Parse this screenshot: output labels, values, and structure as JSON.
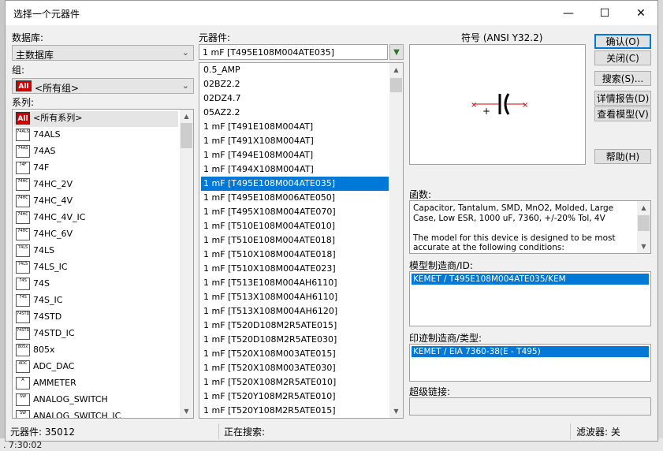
{
  "window": {
    "title": "选择一个元器件",
    "minimize": "—",
    "maximize": "☐",
    "close": "✕"
  },
  "left": {
    "db_label": "数据库:",
    "db_value": "主数据库",
    "group_label": "组:",
    "group_value": "<所有组>",
    "series_label": "系列:",
    "series": [
      {
        "icon": "All",
        "label": "<所有系列>"
      },
      {
        "icon": "74ALS",
        "label": "74ALS"
      },
      {
        "icon": "74AS",
        "label": "74AS"
      },
      {
        "icon": "74F",
        "label": "74F"
      },
      {
        "icon": "74HC",
        "label": "74HC_2V"
      },
      {
        "icon": "74HC",
        "label": "74HC_4V"
      },
      {
        "icon": "74HC",
        "label": "74HC_4V_IC"
      },
      {
        "icon": "74HC",
        "label": "74HC_6V"
      },
      {
        "icon": "74LS",
        "label": "74LS"
      },
      {
        "icon": "74LS",
        "label": "74LS_IC"
      },
      {
        "icon": "74S",
        "label": "74S"
      },
      {
        "icon": "74S",
        "label": "74S_IC"
      },
      {
        "icon": "74STD",
        "label": "74STD"
      },
      {
        "icon": "74STD",
        "label": "74STD_IC"
      },
      {
        "icon": "805x",
        "label": "805x"
      },
      {
        "icon": "ADC",
        "label": "ADC_DAC"
      },
      {
        "icon": "A",
        "label": "AMMETER"
      },
      {
        "icon": "SW",
        "label": "ANALOG_SWITCH"
      },
      {
        "icon": "SW",
        "label": "ANALOG_SWITCH_IC"
      }
    ]
  },
  "middle": {
    "label": "元器件:",
    "filter_value": "1 mF  [T495E108M004ATE035]",
    "items": [
      "0.5_AMP",
      "02BZ2.2",
      "02DZ4.7",
      "05AZ2.2",
      "1 mF  [T491E108M004AT]",
      "1 mF  [T491X108M004AT]",
      "1 mF  [T494E108M004AT]",
      "1 mF  [T494X108M004AT]",
      "1 mF  [T495E108M004ATE035]",
      "1 mF  [T495E108M006ATE050]",
      "1 mF  [T495X108M004ATE070]",
      "1 mF  [T510E108M004ATE010]",
      "1 mF  [T510E108M004ATE018]",
      "1 mF  [T510X108M004ATE018]",
      "1 mF  [T510X108M004ATE023]",
      "1 mF  [T513E108M004AH6110]",
      "1 mF  [T513X108M004AH6110]",
      "1 mF  [T513X108M004AH6120]",
      "1 mF  [T520D108M2R5ATE015]",
      "1 mF  [T520D108M2R5ATE030]",
      "1 mF  [T520X108M003ATE015]",
      "1 mF  [T520X108M003ATE030]",
      "1 mF  [T520X108M2R5ATE010]",
      "1 mF  [T520Y108M2R5ATE010]",
      "1 mF  [T520Y108M2R5ATE015]"
    ],
    "selected_index": 8
  },
  "right": {
    "symbol_label": "符号 (ANSI Y32.2)",
    "function_label": "函数:",
    "function_text": "Capacitor, Tantalum, SMD, MnO2, Molded, Large Case, Low ESR, 1000 uF, 7360, +/-20% Tol, 4V\n\nThe model for this device is designed to be most accurate at the following conditions:",
    "model_label": "模型制造商/ID:",
    "model_value": "KEMET / T495E108M004ATE035/KEM",
    "footprint_label": "印迹制造商/类型:",
    "footprint_value": "KEMET / EIA 7360-38(E - T495)",
    "hyperlink_label": "超级链接:"
  },
  "buttons": {
    "ok": "确认(O)",
    "close": "关闭(C)",
    "search": "搜索(S)...",
    "detail": "详情报告(D)",
    "model": "查看模型(V)",
    "help": "帮助(H)"
  },
  "status": {
    "count": "元器件:  35012",
    "searching": "正在搜索:",
    "filter": "滤波器:  关"
  },
  "bg": {
    "time": ". 7:30:02"
  }
}
